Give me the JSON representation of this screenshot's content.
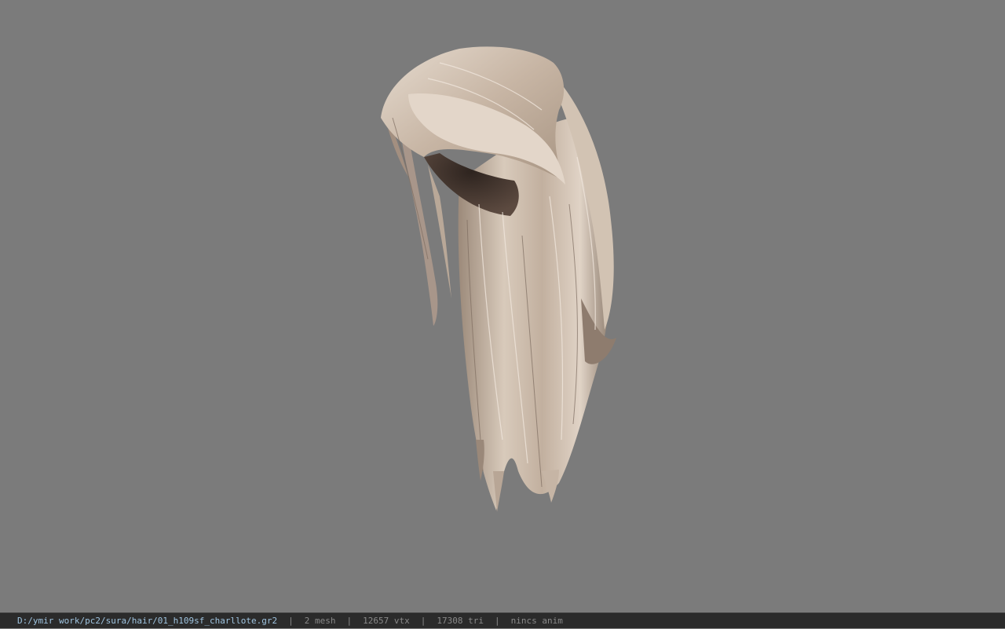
{
  "viewer": {
    "background_color": "#7b7b7b",
    "model": {
      "icon": "hair-model-icon",
      "hair_color": "#c9b9a8",
      "scalp_color": "#4a3a32"
    }
  },
  "statusbar": {
    "file_path": "D:/ymir work/pc2/sura/hair/01_h109sf_charllote.gr2",
    "separator": "|",
    "mesh_count": "2 mesh",
    "vertex_count": "12657 vtx",
    "triangle_count": "17308 tri",
    "anim_status": "nincs anim"
  }
}
